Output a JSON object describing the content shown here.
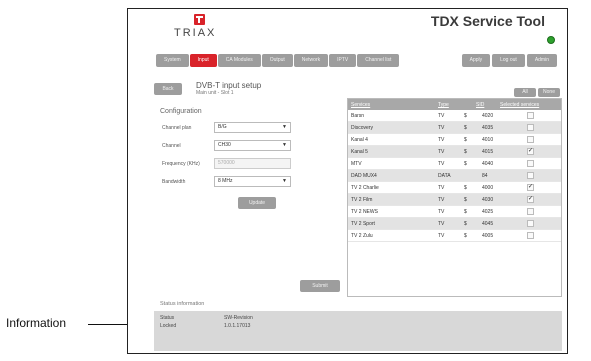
{
  "annotation": {
    "label": "Information"
  },
  "header": {
    "logo_text": "TRIAX",
    "title": "TDX Service Tool",
    "status_color": "#2ea12e"
  },
  "nav": {
    "tabs": [
      "System",
      "Input",
      "CA Modules",
      "Output",
      "Network",
      "IPTV",
      "Channel list"
    ],
    "active": "Input",
    "right_buttons": [
      "Apply",
      "Log out",
      "Admin"
    ]
  },
  "page": {
    "back_label": "Back",
    "title": "DVB-T input setup",
    "subtitle": "Main unit - Slot 1"
  },
  "config": {
    "heading": "Configuration",
    "fields": [
      {
        "label": "Channel plan",
        "value": "B/G",
        "kind": "select"
      },
      {
        "label": "Channel",
        "value": "CH30",
        "kind": "select"
      },
      {
        "label": "Frequency (KHz)",
        "value": "570000",
        "kind": "text"
      },
      {
        "label": "Bandwidth",
        "value": "8 MHz",
        "kind": "select"
      }
    ],
    "update_label": "Update",
    "submit_label": "Submit"
  },
  "services": {
    "top_buttons": [
      "All",
      "None"
    ],
    "headers": {
      "name": "Services",
      "type": "Type",
      "sid": "SID",
      "selected": "Selected services"
    },
    "rows": [
      {
        "name": "Barsn",
        "type": "TV",
        "s": "$",
        "sid": "4020",
        "checked": false
      },
      {
        "name": "Discovery",
        "type": "TV",
        "s": "$",
        "sid": "4035",
        "checked": false
      },
      {
        "name": "Kanal 4",
        "type": "TV",
        "s": "$",
        "sid": "4010",
        "checked": false
      },
      {
        "name": "Kanal 5",
        "type": "TV",
        "s": "$",
        "sid": "4015",
        "checked": true
      },
      {
        "name": "MTV",
        "type": "TV",
        "s": "$",
        "sid": "4040",
        "checked": false
      },
      {
        "name": "DAD MUX4",
        "type": "DATA",
        "s": "",
        "sid": "84",
        "checked": false
      },
      {
        "name": "TV 2 Charlie",
        "type": "TV",
        "s": "$",
        "sid": "4000",
        "checked": true
      },
      {
        "name": "TV 2 Film",
        "type": "TV",
        "s": "$",
        "sid": "4030",
        "checked": true
      },
      {
        "name": "TV 2 NEWS",
        "type": "TV",
        "s": "$",
        "sid": "4025",
        "checked": false
      },
      {
        "name": "TV 2 Sport",
        "type": "TV",
        "s": "$",
        "sid": "4045",
        "checked": false
      },
      {
        "name": "TV 2 Zulu",
        "type": "TV",
        "s": "$",
        "sid": "4005",
        "checked": false
      }
    ]
  },
  "status": {
    "title": "Status information",
    "lines": [
      {
        "key": "Status",
        "value": "SW-Revision"
      },
      {
        "key": "Locked",
        "value": "1.0.1.17013"
      }
    ]
  }
}
